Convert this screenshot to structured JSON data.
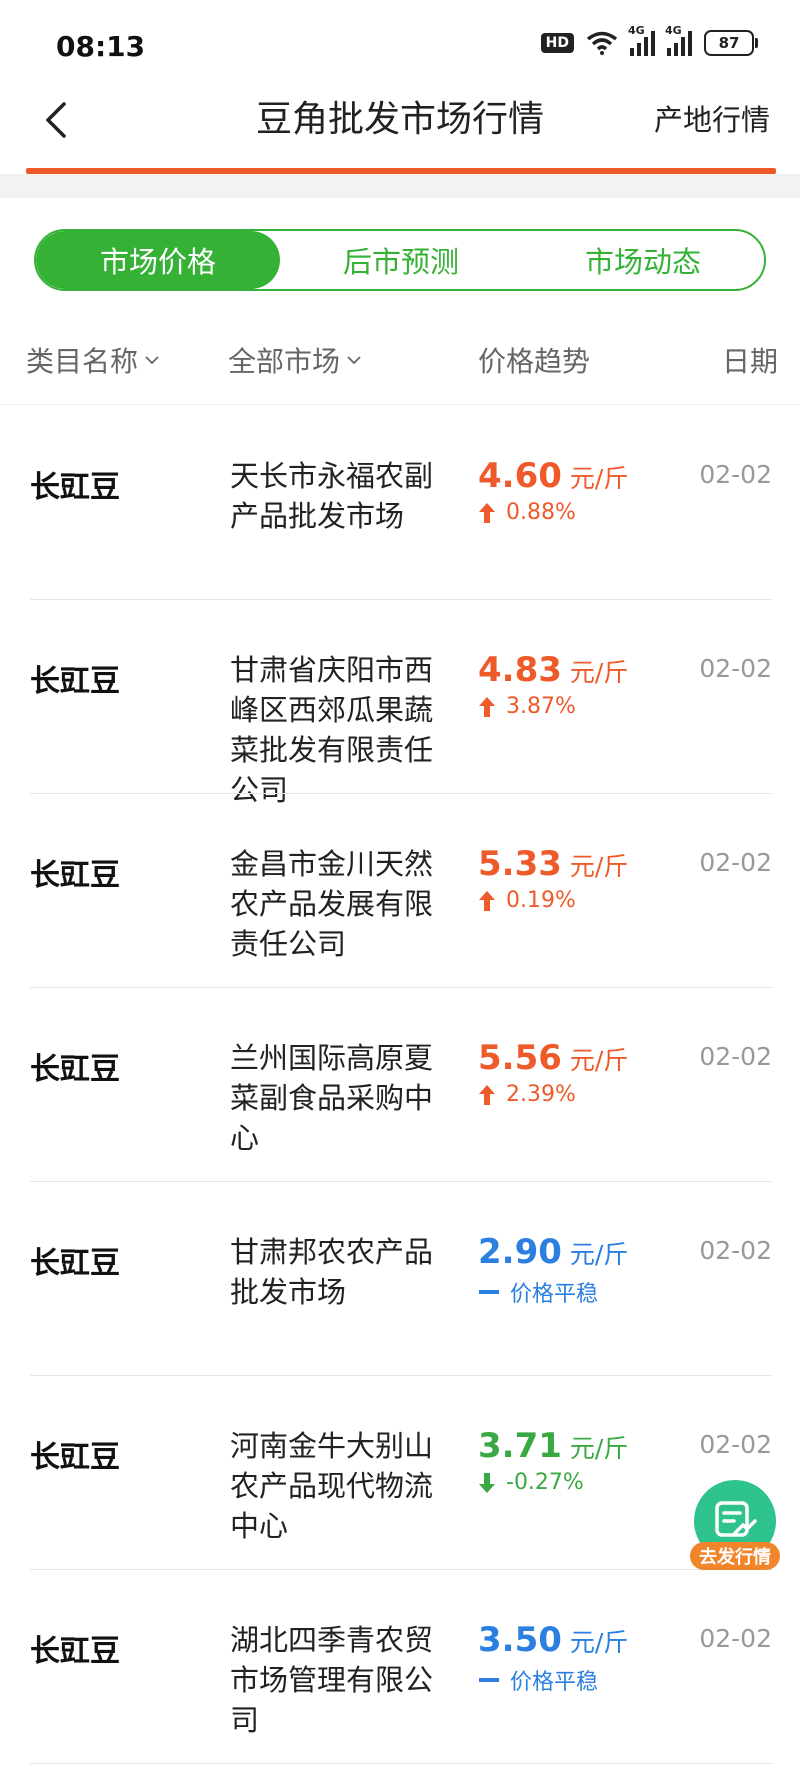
{
  "status_bar": {
    "time": "08:13",
    "hd": "HD",
    "signal1": "4G",
    "signal2": "4G",
    "battery": "87"
  },
  "nav": {
    "title": "豆角批发市场行情",
    "right_link": "产地行情"
  },
  "tabs": [
    {
      "label": "市场价格",
      "active": true
    },
    {
      "label": "后市预测",
      "active": false
    },
    {
      "label": "市场动态",
      "active": false
    }
  ],
  "columns": {
    "category": "类目名称",
    "market": "全部市场",
    "trend": "价格趋势",
    "date": "日期"
  },
  "colors": {
    "accent_green": "#35b236",
    "up_red": "#ee5a2a",
    "flat_blue": "#2b7fe0",
    "down_green": "#3aa943"
  },
  "unit": "元/斤",
  "rows": [
    {
      "category": "长豇豆",
      "market": "天长市永福农副产品批发市场",
      "price": "4.60",
      "trend": "up",
      "change": "0.88%",
      "date": "02-02"
    },
    {
      "category": "长豇豆",
      "market": "甘肃省庆阳市西峰区西郊瓜果蔬菜批发有限责任公司",
      "price": "4.83",
      "trend": "up",
      "change": "3.87%",
      "date": "02-02"
    },
    {
      "category": "长豇豆",
      "market": "金昌市金川天然农产品发展有限责任公司",
      "price": "5.33",
      "trend": "up",
      "change": "0.19%",
      "date": "02-02"
    },
    {
      "category": "长豇豆",
      "market": "兰州国际高原夏菜副食品采购中心",
      "price": "5.56",
      "trend": "up",
      "change": "2.39%",
      "date": "02-02"
    },
    {
      "category": "长豇豆",
      "market": "甘肃邦农农产品批发市场",
      "price": "2.90",
      "trend": "flat",
      "change": "价格平稳",
      "date": "02-02"
    },
    {
      "category": "长豇豆",
      "market": "河南金牛大别山农产品现代物流中心",
      "price": "3.71",
      "trend": "down",
      "change": "-0.27%",
      "date": "02-02"
    },
    {
      "category": "长豇豆",
      "market": "湖北四季青农贸市场管理有限公司",
      "price": "3.50",
      "trend": "flat",
      "change": "价格平稳",
      "date": "02-02"
    }
  ],
  "fab": {
    "label": "去发行情",
    "icon": "post-quote-icon"
  }
}
